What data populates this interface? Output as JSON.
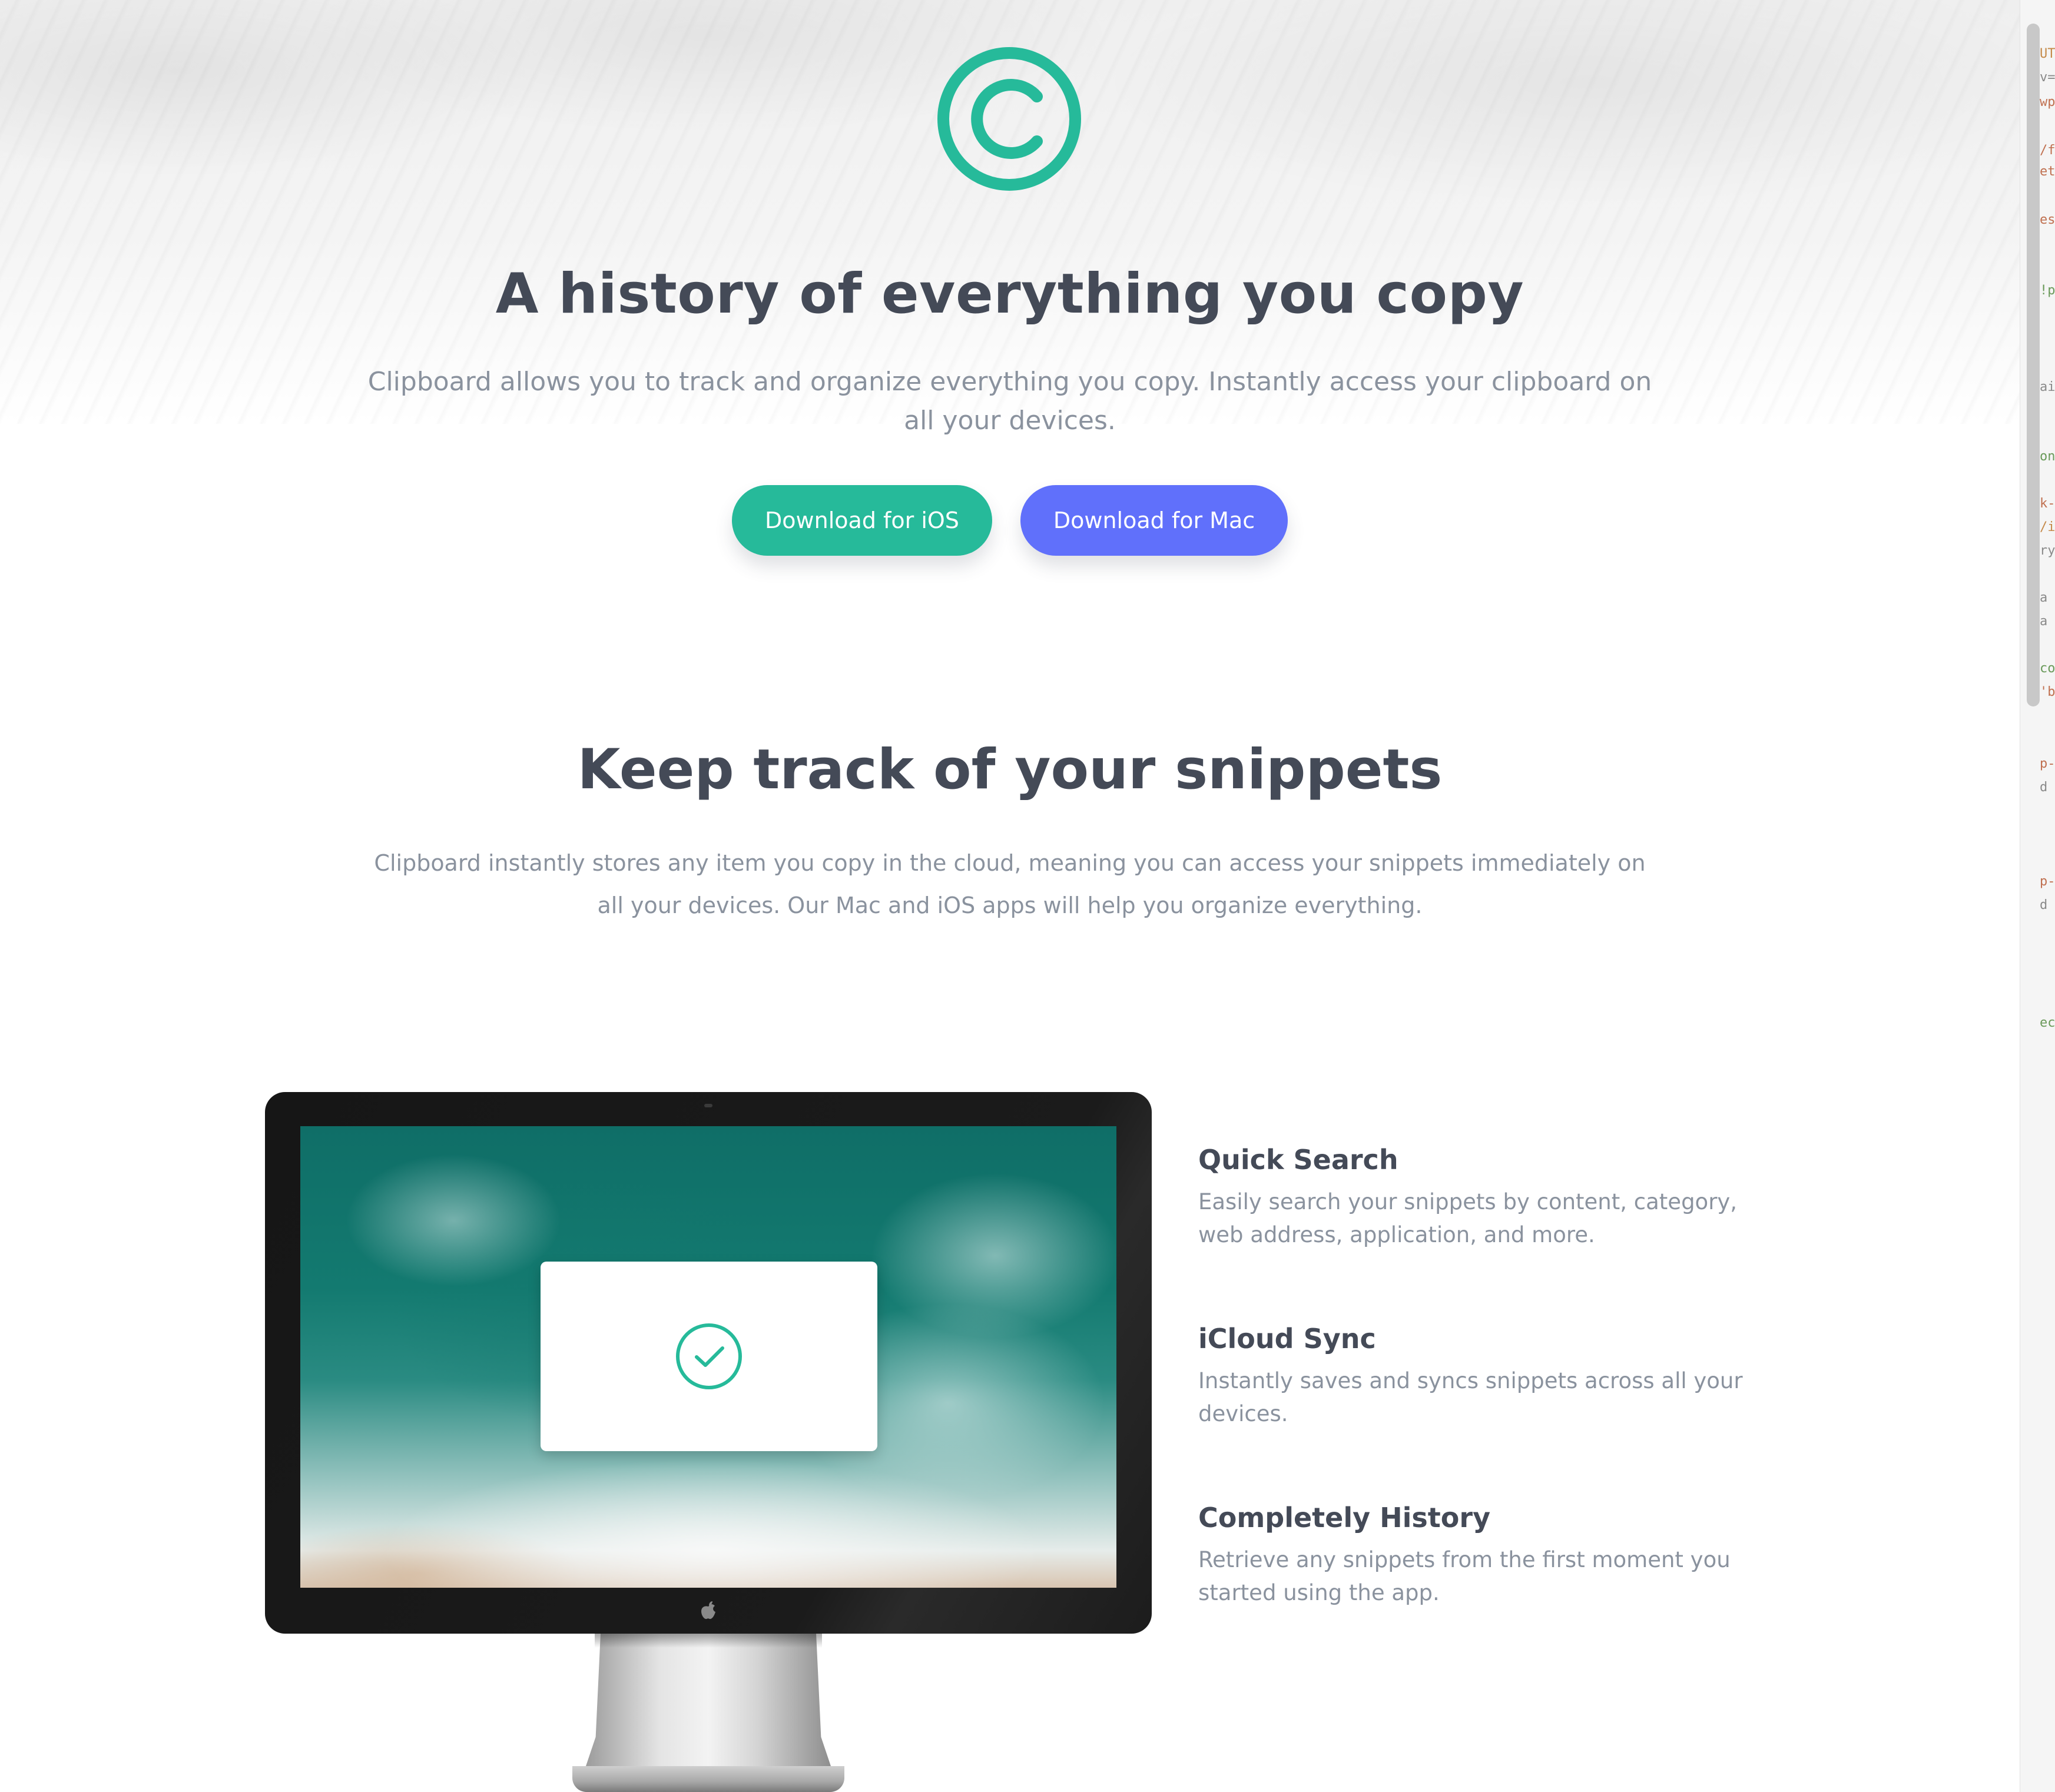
{
  "hero": {
    "logo_icon": "copyright-logo-icon",
    "title": "A history of everything you copy",
    "text": "Clipboard allows you to track and organize everything you copy. Instantly access your clipboard on all your devices.",
    "buttons": {
      "ios": "Download for iOS",
      "mac": "Download for Mac"
    }
  },
  "snippets": {
    "title": "Keep track of your snippets",
    "text": "Clipboard instantly stores any item you copy in the cloud, meaning you can access your snippets immediately on all your devices. Our Mac and iOS apps will help you organize everything."
  },
  "features": [
    {
      "title": "Quick Search",
      "text": "Easily search your snippets by content, category, web address, application, and more."
    },
    {
      "title": "iCloud Sync",
      "text": "Instantly saves and syncs snippets across all your devices."
    },
    {
      "title": "Completely History",
      "text": "Retrieve any snippets from the first moment you started using the app."
    }
  ],
  "devtools_fragments": [
    "UT",
    "v=",
    "wp",
    "/f",
    "et",
    "es",
    "!p",
    "ai",
    "on",
    "k-",
    "/i",
    "ry",
    "a",
    "a",
    "co",
    "'b",
    "p-",
    "d",
    "p-",
    "d",
    "ec"
  ],
  "colors": {
    "accent_teal": "#26ba9a",
    "accent_blue": "#6070fb",
    "heading": "#444a57",
    "body_text": "#8a929e"
  }
}
